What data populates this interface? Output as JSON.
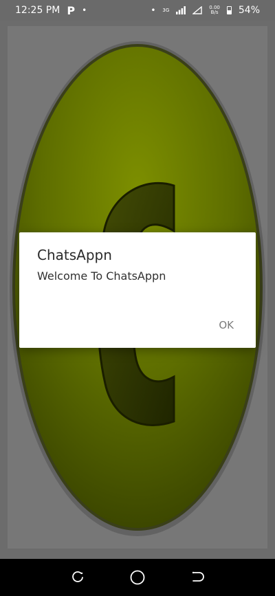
{
  "status_bar": {
    "time": "12:25 PM",
    "notification_letter": "P",
    "dot": "•",
    "right_dot": "•",
    "network_type": "3G",
    "speed_value": "0.00",
    "speed_unit": "B/s",
    "battery": "54%",
    "icons": [
      "parking-p-icon",
      "signal-bars-icon",
      "wifi-triangle-icon",
      "battery-icon"
    ]
  },
  "app": {
    "logo_letter": "C",
    "colors": {
      "background": "#6c6c6c",
      "ellipse_center": "#7a8c00",
      "ellipse_edge": "#3e4a00",
      "letter": "#2b3200"
    }
  },
  "dialog": {
    "title": "ChatsAppn",
    "message": "Welcome To ChatsAppn",
    "ok_label": "OK"
  },
  "nav_bar": {
    "icons": [
      "recent-apps-icon",
      "home-icon",
      "back-icon"
    ]
  }
}
